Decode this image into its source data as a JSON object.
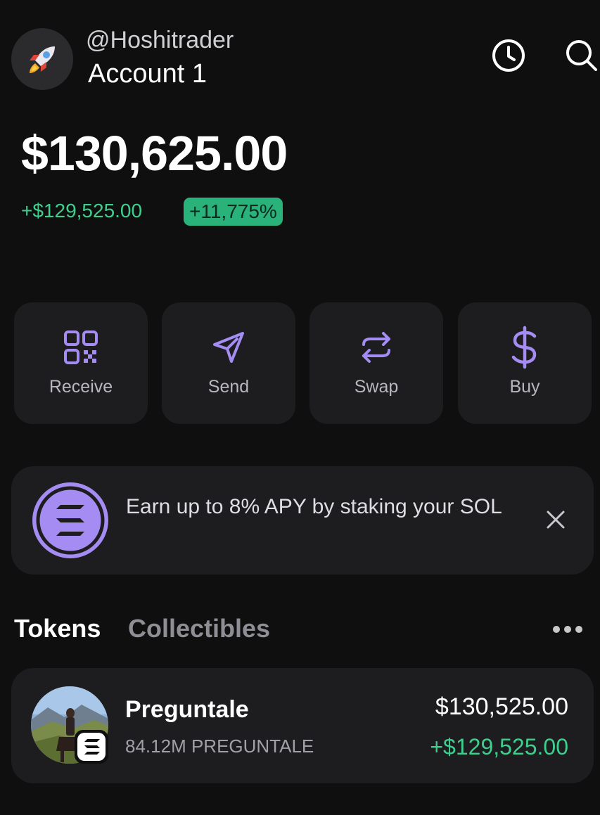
{
  "header": {
    "avatar_icon": "rocket-icon",
    "username": "@Hoshitrader",
    "account_name": "Account 1",
    "icons": [
      "clock-history-icon",
      "search-icon"
    ]
  },
  "balance": {
    "total": "$130,625.00",
    "change": "+$129,525.00",
    "change_percent": "+11,775%"
  },
  "actions": [
    {
      "label": "Receive",
      "icon": "qr-code-icon"
    },
    {
      "label": "Send",
      "icon": "paper-plane-icon"
    },
    {
      "label": "Swap",
      "icon": "swap-arrows-icon"
    },
    {
      "label": "Buy",
      "icon": "dollar-icon"
    }
  ],
  "promo": {
    "text": "Earn up to 8% APY by staking your SOL",
    "icon": "solana-icon"
  },
  "tabs": {
    "tokens": "Tokens",
    "collectibles": "Collectibles",
    "active": "Tokens"
  },
  "tokens": [
    {
      "name": "Preguntale",
      "amount": "84.12M PREGUNTALE",
      "value": "$130,525.00",
      "change": "+$129,525.00",
      "chain_icon": "solana-icon"
    }
  ],
  "colors": {
    "background": "#0f0f10",
    "card": "#1d1d20",
    "accent": "#a58cf2",
    "positive": "#3ecf8e",
    "badge": "#29b37a"
  }
}
